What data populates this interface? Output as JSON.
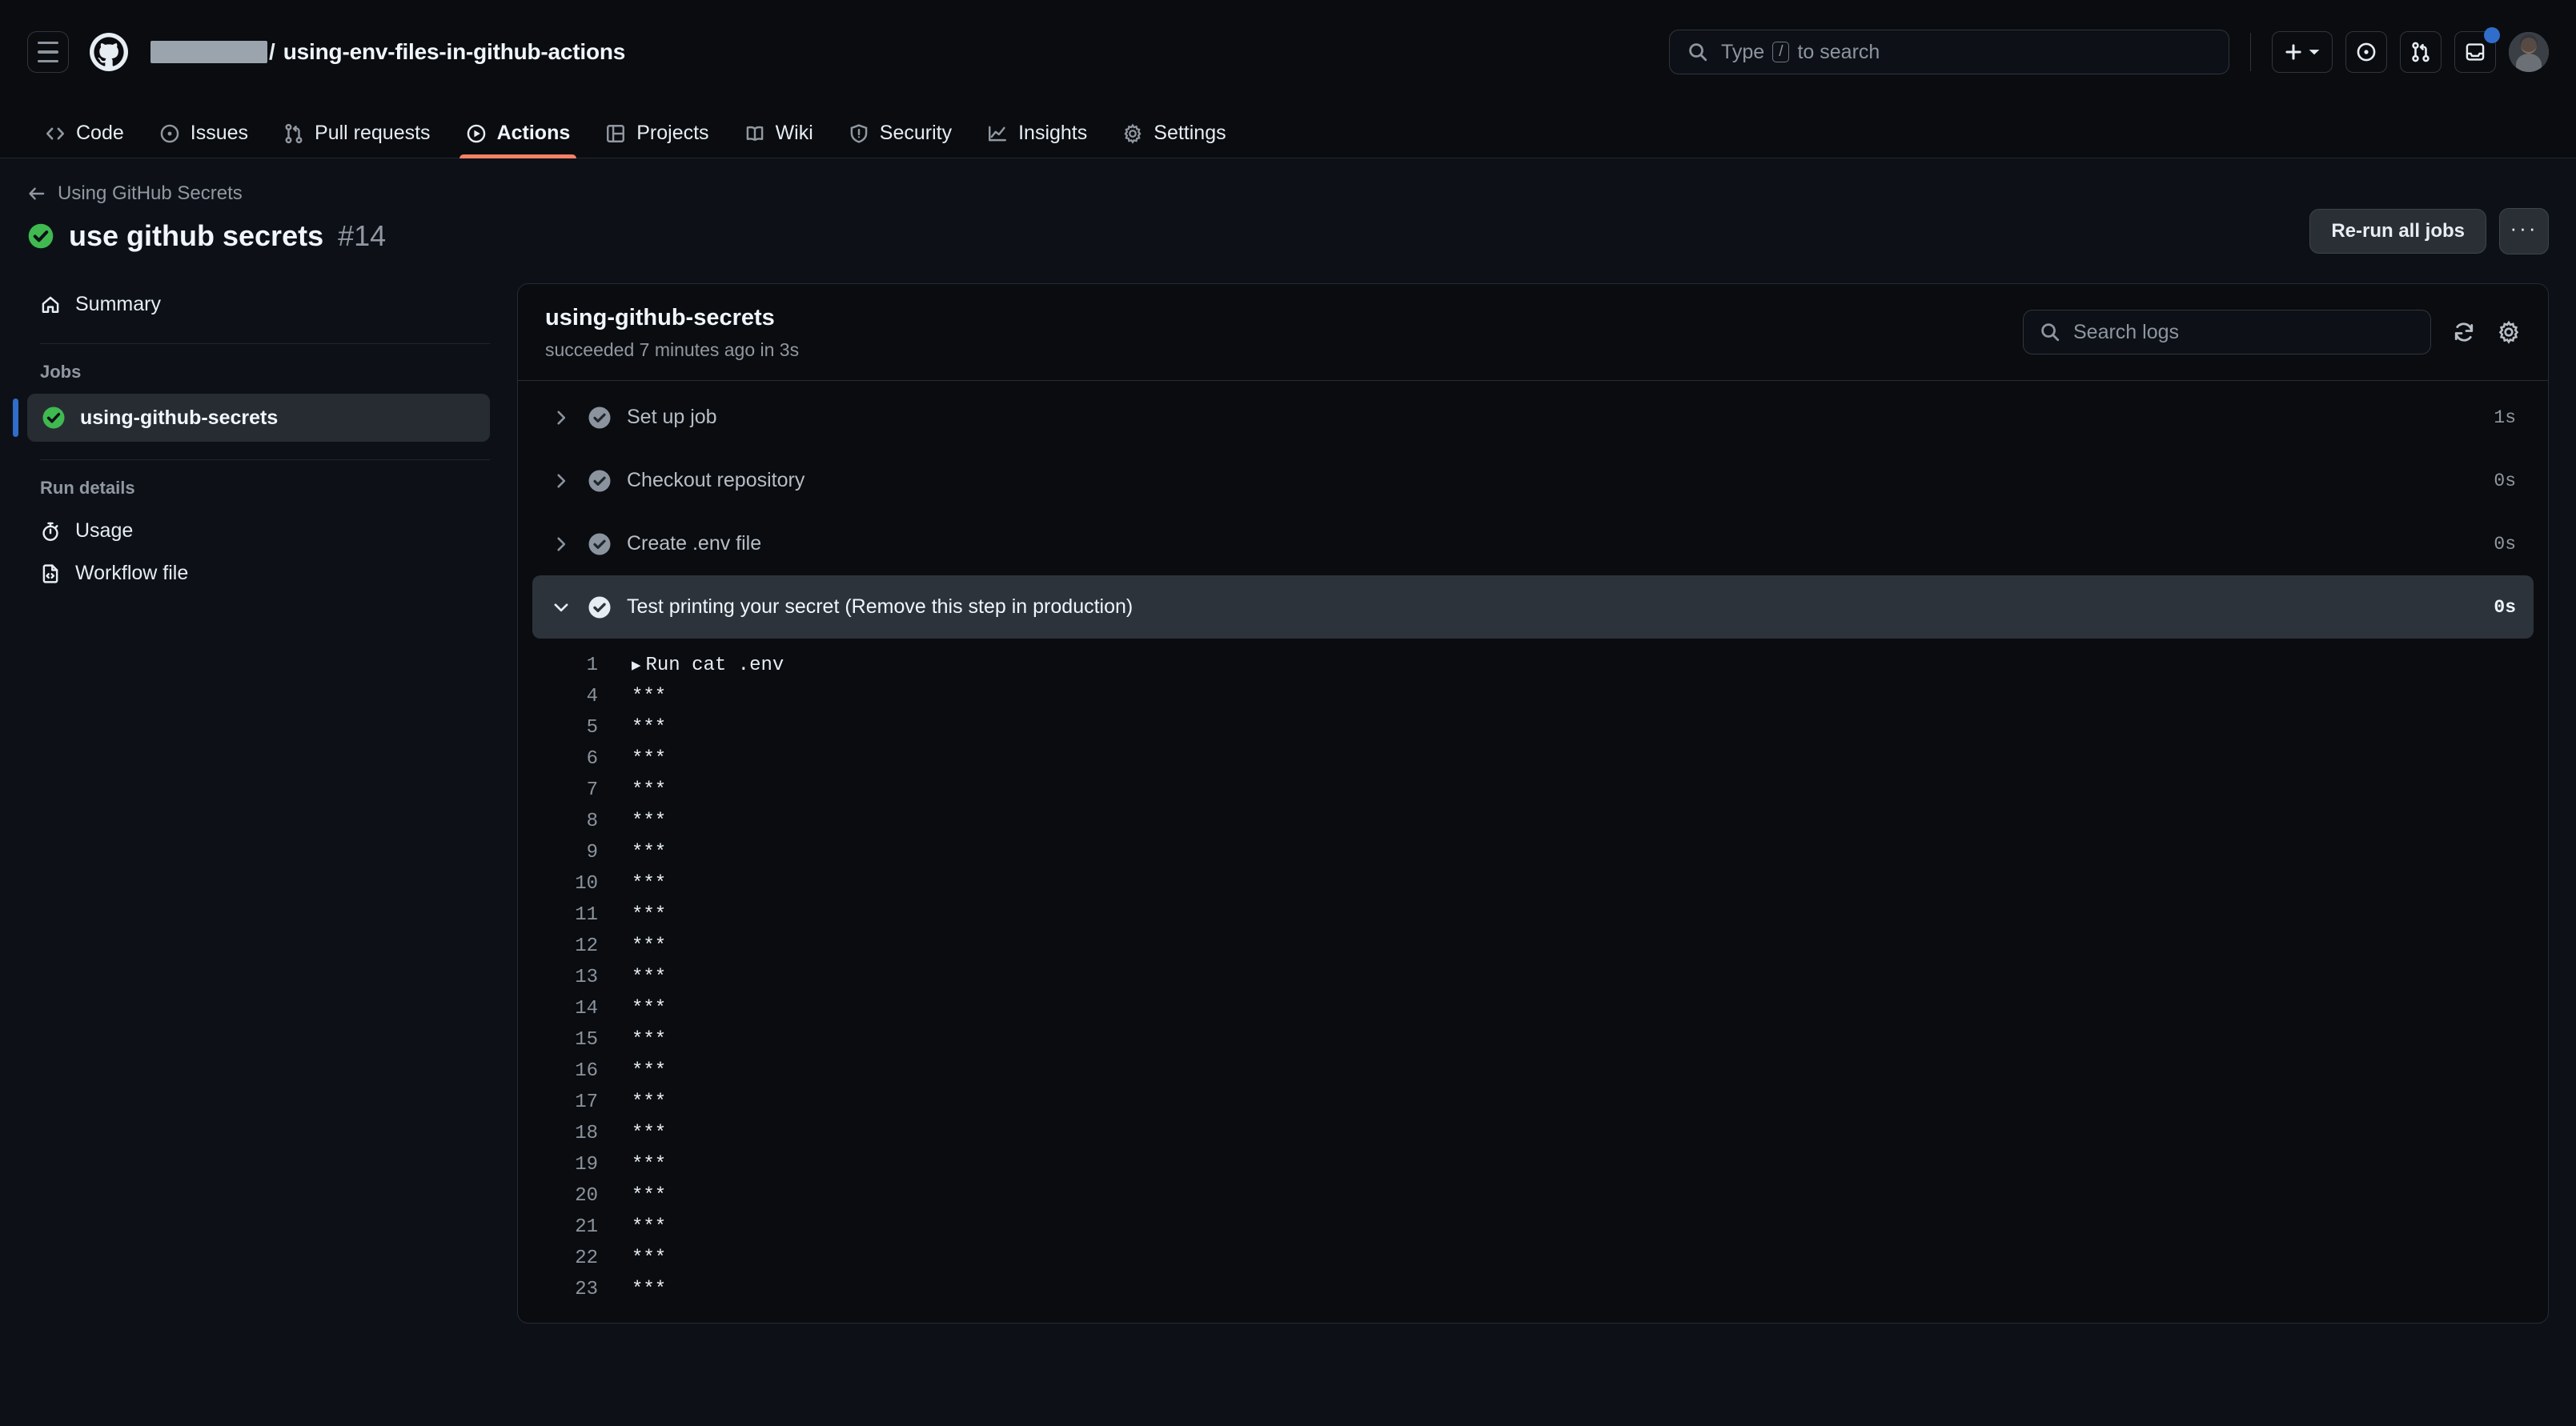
{
  "header": {
    "menu_icon": "hamburger-icon",
    "logo_icon": "github-logo-icon",
    "owner_redacted": true,
    "separator": "/",
    "repo_name": "using-env-files-in-github-actions",
    "search": {
      "placeholder_prefix": "Type",
      "key_hint": "/",
      "placeholder_suffix": "to search",
      "icon": "search-icon"
    },
    "actions": [
      {
        "name": "create-new-button",
        "icon": "plus-icon",
        "has_dropdown": true
      },
      {
        "name": "issues-button",
        "icon": "issue-opened-icon"
      },
      {
        "name": "pull-requests-button",
        "icon": "git-pull-request-icon"
      },
      {
        "name": "inbox-button",
        "icon": "inbox-icon",
        "has_notification": true
      }
    ],
    "avatar": "user-avatar"
  },
  "repo_nav": {
    "tabs": [
      {
        "label": "Code",
        "icon": "code-icon",
        "active": false
      },
      {
        "label": "Issues",
        "icon": "issue-opened-icon",
        "active": false
      },
      {
        "label": "Pull requests",
        "icon": "git-pull-request-icon",
        "active": false
      },
      {
        "label": "Actions",
        "icon": "play-icon",
        "active": true
      },
      {
        "label": "Projects",
        "icon": "table-icon",
        "active": false
      },
      {
        "label": "Wiki",
        "icon": "book-icon",
        "active": false
      },
      {
        "label": "Security",
        "icon": "shield-icon",
        "active": false
      },
      {
        "label": "Insights",
        "icon": "graph-icon",
        "active": false
      },
      {
        "label": "Settings",
        "icon": "gear-icon",
        "active": false
      }
    ]
  },
  "run": {
    "back_label": "Using GitHub Secrets",
    "back_icon": "arrow-left-icon",
    "status_icon": "check-circle-success-icon",
    "title": "use github secrets",
    "number": "#14",
    "rerun_label": "Re-run all jobs",
    "more_label": "···"
  },
  "sidebar": {
    "summary": {
      "label": "Summary",
      "icon": "home-icon"
    },
    "jobs_label": "Jobs",
    "jobs": [
      {
        "label": "using-github-secrets",
        "icon": "check-circle-success-icon",
        "selected": true
      }
    ],
    "run_details_label": "Run details",
    "details": [
      {
        "label": "Usage",
        "icon": "stopwatch-icon"
      },
      {
        "label": "Workflow file",
        "icon": "file-code-icon"
      }
    ]
  },
  "log_panel": {
    "job_title": "using-github-secrets",
    "job_status": "succeeded 7 minutes ago in 3s",
    "search": {
      "placeholder": "Search logs",
      "icon": "search-icon"
    },
    "refresh_icon": "sync-icon",
    "settings_icon": "gear-icon",
    "steps": [
      {
        "name": "Set up job",
        "duration": "1s",
        "expanded": false,
        "status": "success"
      },
      {
        "name": "Checkout repository",
        "duration": "0s",
        "expanded": false,
        "status": "success"
      },
      {
        "name": "Create .env file",
        "duration": "0s",
        "expanded": false,
        "status": "success"
      },
      {
        "name": "Test printing your secret (Remove this step in production)",
        "duration": "0s",
        "expanded": true,
        "status": "success"
      }
    ],
    "log_lines": [
      {
        "n": "1",
        "text": "Run cat .env",
        "group": true
      },
      {
        "n": "4",
        "text": "***"
      },
      {
        "n": "5",
        "text": "***"
      },
      {
        "n": "6",
        "text": "***"
      },
      {
        "n": "7",
        "text": "***"
      },
      {
        "n": "8",
        "text": "***"
      },
      {
        "n": "9",
        "text": "***"
      },
      {
        "n": "10",
        "text": "***"
      },
      {
        "n": "11",
        "text": "***"
      },
      {
        "n": "12",
        "text": "***"
      },
      {
        "n": "13",
        "text": "***"
      },
      {
        "n": "14",
        "text": "***"
      },
      {
        "n": "15",
        "text": "***"
      },
      {
        "n": "16",
        "text": "***"
      },
      {
        "n": "17",
        "text": "***"
      },
      {
        "n": "18",
        "text": "***"
      },
      {
        "n": "19",
        "text": "***"
      },
      {
        "n": "20",
        "text": "***"
      },
      {
        "n": "21",
        "text": "***"
      },
      {
        "n": "22",
        "text": "***"
      },
      {
        "n": "23",
        "text": "***"
      }
    ]
  },
  "colors": {
    "page_bg": "#0d1117",
    "header_bg": "#0a0c10",
    "accent_active_tab": "#f78166",
    "success_green": "#3fb950",
    "selected_blue": "#316dca",
    "row_highlight": "#2d333b",
    "muted_text": "#9198a1"
  }
}
